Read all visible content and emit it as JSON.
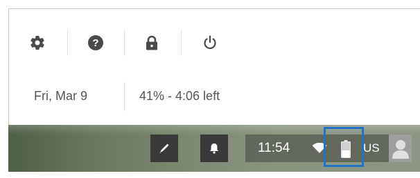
{
  "quick_settings": {
    "icons": [
      {
        "name": "settings",
        "icon": "gear-icon"
      },
      {
        "name": "help",
        "icon": "help-icon"
      },
      {
        "name": "lock",
        "icon": "lock-icon"
      },
      {
        "name": "power",
        "icon": "power-icon"
      }
    ],
    "date": "Fri, Mar 9",
    "battery_status": "41% - 4:06 left",
    "battery_percent": 41
  },
  "shelf": {
    "stylus_icon": "stylus-icon",
    "notifications_icon": "bell-icon",
    "clock": "11:54",
    "wifi_icon": "wifi-icon",
    "battery_icon": "battery-icon",
    "ime": "US",
    "avatar_icon": "avatar-icon"
  },
  "colors": {
    "highlight": "#1f73c9",
    "tray_button": "#3a3a3a",
    "icon_dark": "#4a4a4a"
  }
}
